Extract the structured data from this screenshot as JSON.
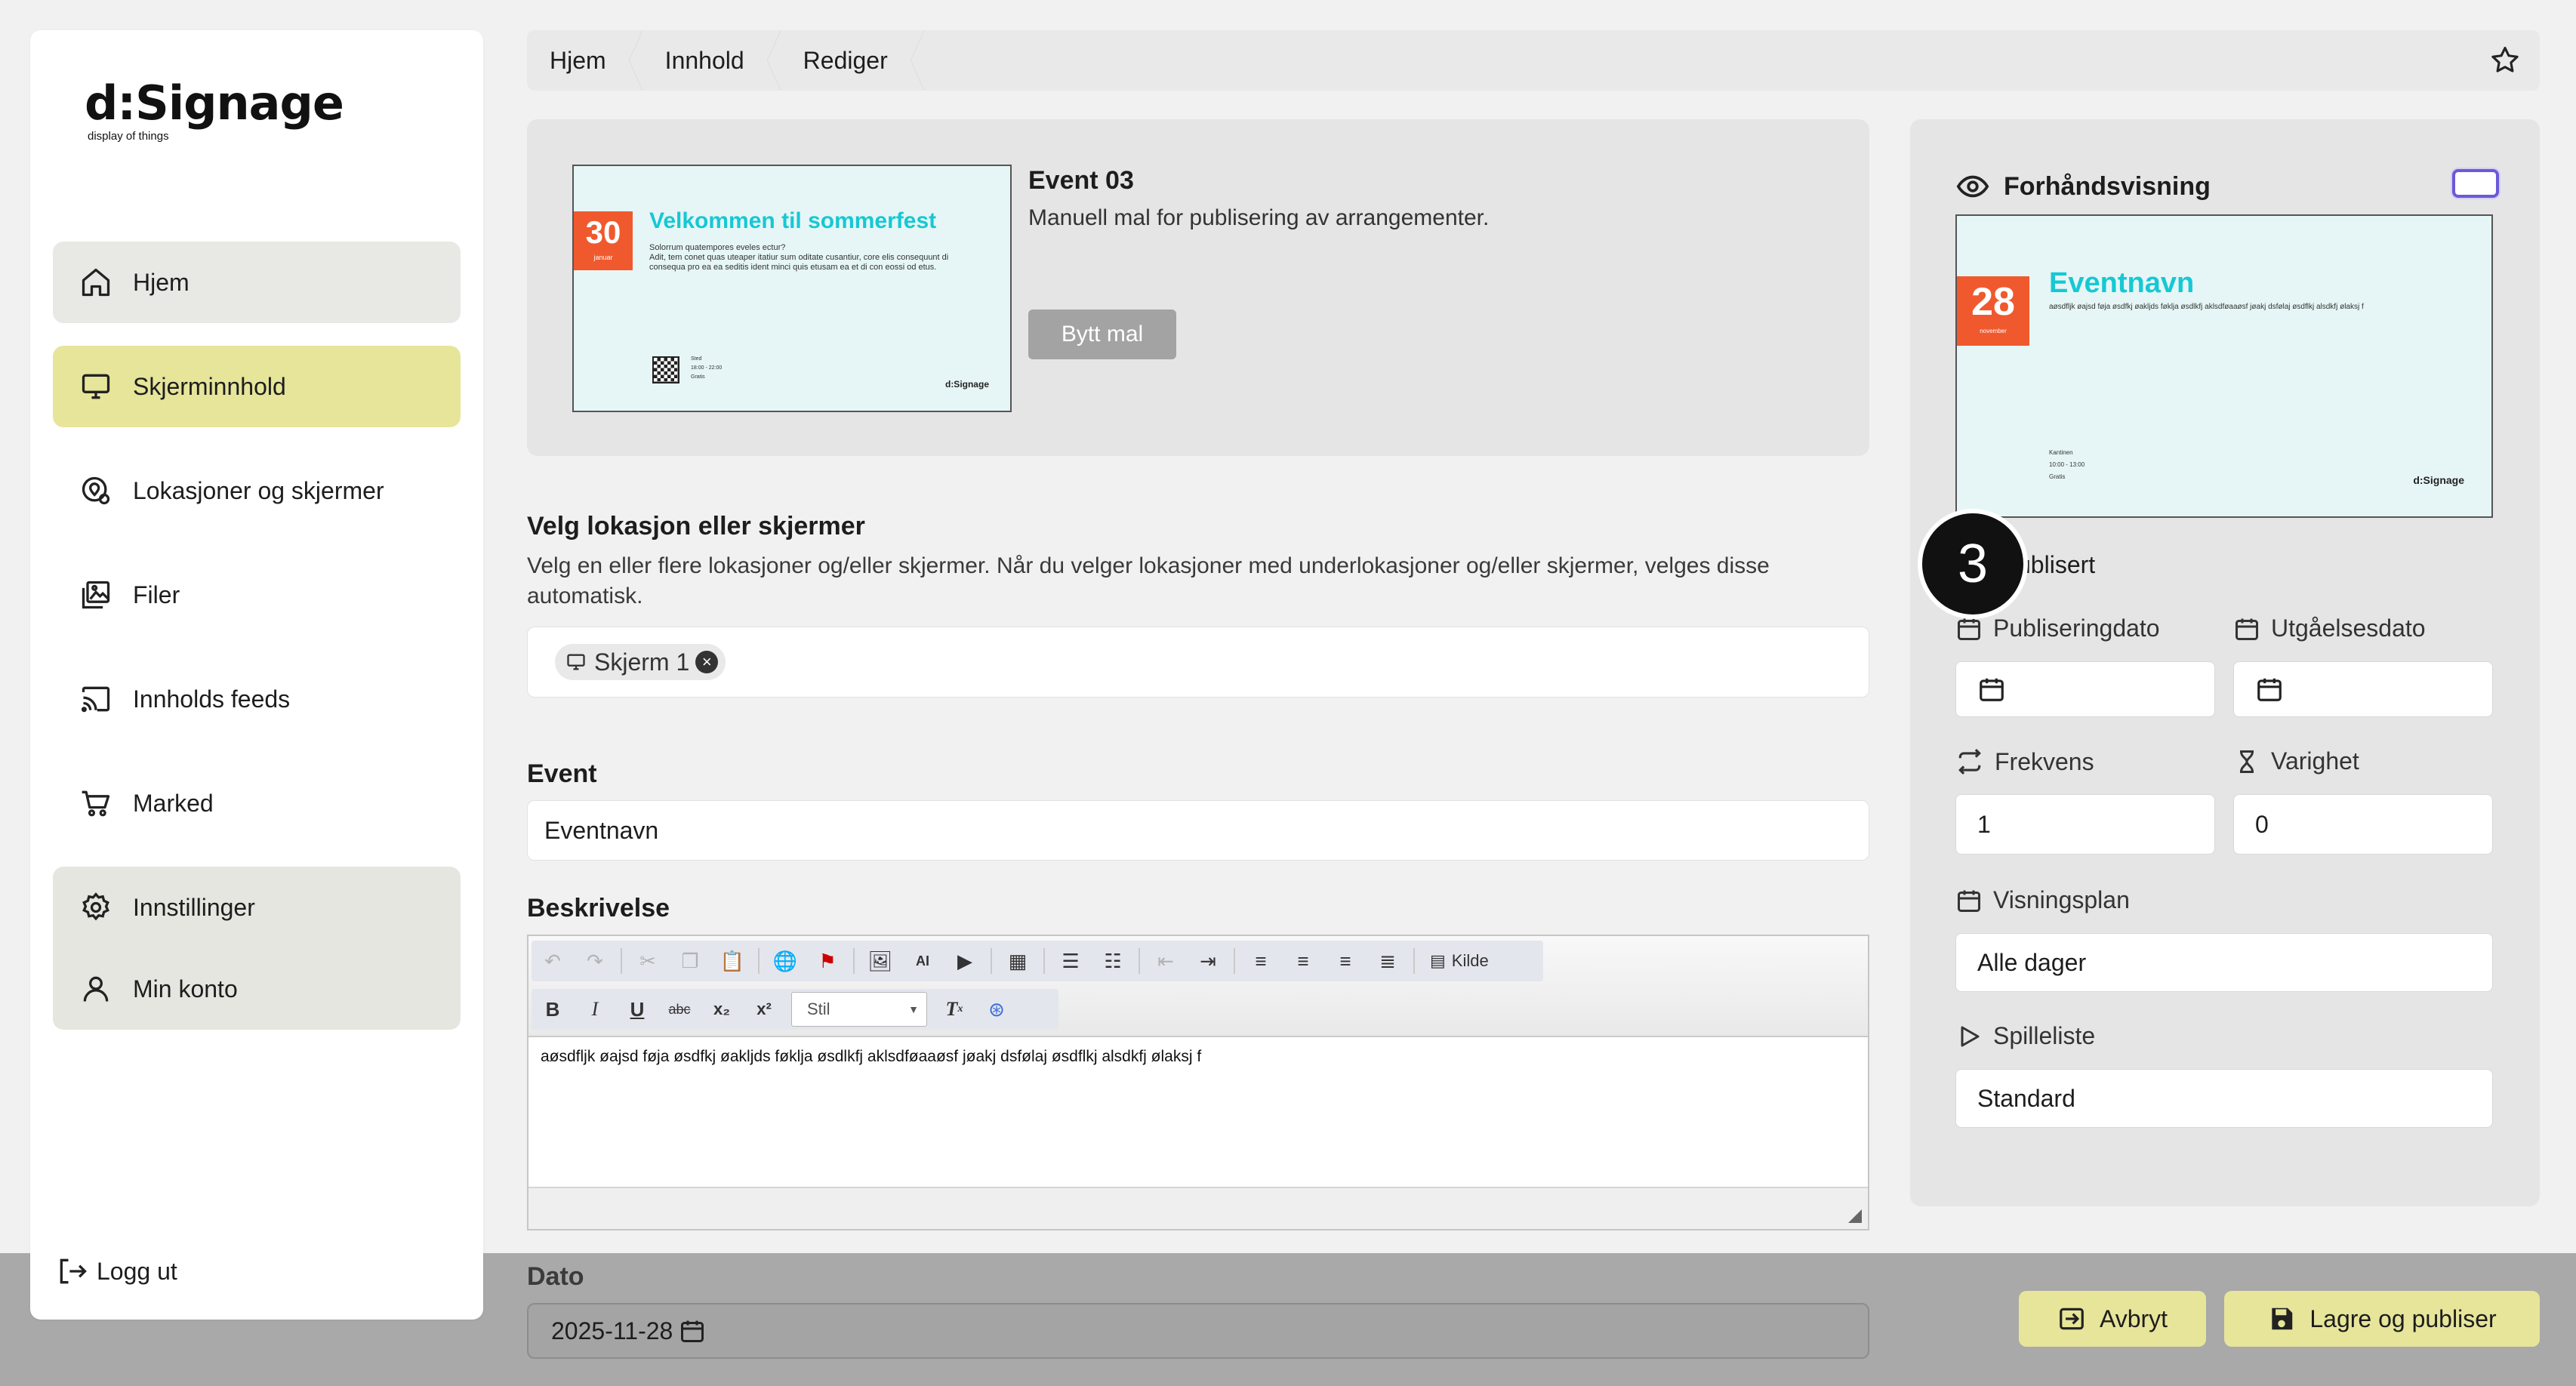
{
  "logo": {
    "main": "d:Signage",
    "sub": "display of things"
  },
  "nav": {
    "home": "Hjem",
    "screen_content": "Skjerminnhold",
    "locations": "Lokasjoner og skjermer",
    "files": "Filer",
    "feeds": "Innholds feeds",
    "market": "Marked",
    "settings": "Innstillinger",
    "account": "Min konto",
    "logout": "Logg ut"
  },
  "breadcrumb": [
    "Hjem",
    "Innhold",
    "Rediger"
  ],
  "template": {
    "name": "Event 03",
    "description": "Manuell mal for publisering av arrangementer.",
    "change_button": "Bytt mal",
    "thumb": {
      "day": "30",
      "month": "januar",
      "title": "Velkommen til sommerfest",
      "line1": "Solorrum quatempores eveles ectur?",
      "line2": "Adit, tem conet quas uteaper itatiur sum oditate cusantiur, core elis consequunt di consequa pro ea ea seditis ident minci quis etusam ea et di con eossi od etus.",
      "meta1": "Sted",
      "meta2": "18:00 - 22:00",
      "meta3": "Gratis",
      "brand": "d:Signage"
    }
  },
  "targets": {
    "label": "Velg lokasjon eller skjermer",
    "help": "Velg en eller flere lokasjoner og/eller skjermer. Når du velger lokasjoner med underlokasjoner og/eller skjermer, velges disse automatisk.",
    "chip": "Skjerm 1"
  },
  "event": {
    "label": "Event",
    "value": "Eventnavn"
  },
  "description": {
    "label": "Beskrivelse",
    "style_placeholder": "Stil",
    "source_label": "Kilde",
    "content": "aøsdfljk øajsd føja øsdfkj øakljds føklja øsdlkfj aklsdføaaøsf jøakj dsfølaj øsdflkj alsdkfj ølaksj f"
  },
  "dato": {
    "label": "Dato",
    "value": "2025-11-28"
  },
  "preview": {
    "title": "Forhåndsvisning",
    "day": "28",
    "month": "november",
    "event_title": "Eventnavn",
    "event_desc": "aøsdfljk øajsd føja øsdfkj øakljds føklja øsdlkfj aklsdføaaøsf jøakj dsfølaj øsdflkj alsdkfj ølaksj f",
    "meta1": "Kantinen",
    "meta2": "10:00 - 13:00",
    "meta3": "Gratis",
    "brand": "d:Signage"
  },
  "publish": {
    "step": "3",
    "label": "ublisert",
    "pub_date_label": "Publiseringdato",
    "exp_date_label": "Utgåelsesdato",
    "frequency_label": "Frekvens",
    "frequency_value": "1",
    "duration_label": "Varighet",
    "duration_value": "0",
    "schedule_label": "Visningsplan",
    "schedule_value": "Alle dager",
    "playlist_label": "Spilleliste",
    "playlist_value": "Standard"
  },
  "actions": {
    "cancel": "Avbryt",
    "save": "Lagre og publiser"
  },
  "colors": {
    "accent": "#e6e59a",
    "brand_orange": "#f0592e",
    "brand_cyan": "#16c8d4",
    "toggle": "#6b5ad6"
  }
}
